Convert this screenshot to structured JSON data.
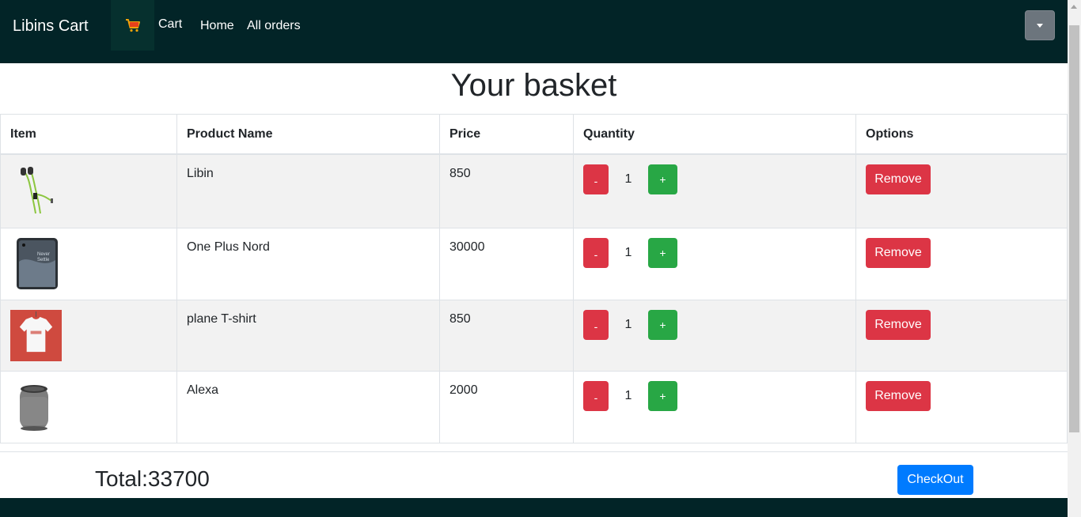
{
  "navbar": {
    "brand": "Libins Cart",
    "cart_label": "Cart",
    "links": [
      "Home",
      "All orders"
    ]
  },
  "page": {
    "title": "Your basket"
  },
  "table": {
    "headers": [
      "Item",
      "Product Name",
      "Price",
      "Quantity",
      "Options"
    ],
    "rows": [
      {
        "image": "earphones",
        "name": "Libin",
        "price": "850",
        "quantity": "1"
      },
      {
        "image": "smartphone",
        "name": "One Plus Nord",
        "price": "30000",
        "quantity": "1"
      },
      {
        "image": "t-shirt",
        "name": "plane T-shirt",
        "price": "850",
        "quantity": "1"
      },
      {
        "image": "smart-speaker",
        "name": "Alexa",
        "price": "2000",
        "quantity": "1"
      }
    ],
    "minus_label": "-",
    "plus_label": "+",
    "remove_label": "Remove"
  },
  "summary": {
    "total": "Total:33700",
    "checkout_label": "CheckOut"
  },
  "colors": {
    "navbar": "#022427",
    "danger": "#dc3545",
    "success": "#28a745",
    "primary": "#007bff",
    "secondary": "#6c757d"
  }
}
